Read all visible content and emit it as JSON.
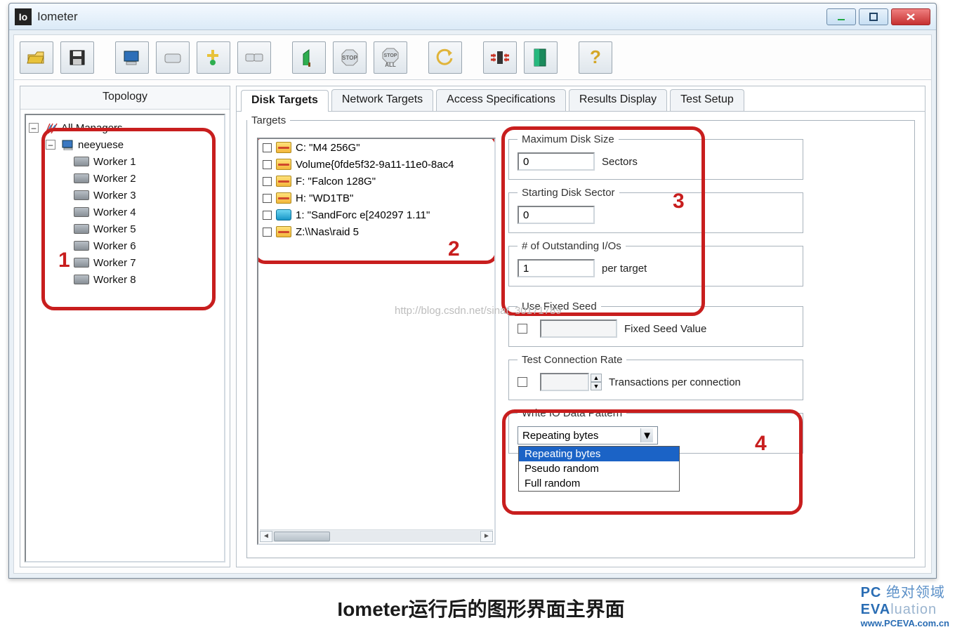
{
  "window": {
    "title": "Iometer",
    "app_icon_text": "Io"
  },
  "winbuttons": {
    "min": "minimize",
    "max": "maximize",
    "close": "close"
  },
  "toolbar": {
    "buttons": [
      {
        "name": "open",
        "color": "#e8c23a"
      },
      {
        "name": "save",
        "color": "#333"
      },
      {
        "name": "computer",
        "color": "#2d6fb8"
      },
      {
        "name": "add-manager",
        "color": "#888"
      },
      {
        "name": "add-worker",
        "color": "#2eae4f"
      },
      {
        "name": "copy-worker",
        "color": "#888"
      },
      {
        "name": "start",
        "color": "#2eae4f"
      },
      {
        "name": "stop",
        "color": "#b44"
      },
      {
        "name": "stop-all",
        "color": "#b44"
      },
      {
        "name": "reset",
        "color": "#e0b43a"
      },
      {
        "name": "dock",
        "color": "#c83426"
      },
      {
        "name": "exit",
        "color": "#1a8a5c"
      },
      {
        "name": "help",
        "color": "#d4a728"
      }
    ]
  },
  "topology": {
    "header": "Topology",
    "root": "All Managers",
    "manager": "neeyuese",
    "workers": [
      "Worker 1",
      "Worker 2",
      "Worker 3",
      "Worker 4",
      "Worker 5",
      "Worker 6",
      "Worker 7",
      "Worker 8"
    ]
  },
  "tabs": [
    "Disk Targets",
    "Network Targets",
    "Access Specifications",
    "Results Display",
    "Test Setup"
  ],
  "active_tab": 0,
  "targets_group": "Targets",
  "targets": [
    {
      "icon": "yellow",
      "label": "C: \"M4 256G\""
    },
    {
      "icon": "yellow",
      "label": "Volume{0fde5f32-9a11-11e0-8ac4"
    },
    {
      "icon": "yellow",
      "label": "F: \"Falcon 128G\""
    },
    {
      "icon": "yellow",
      "label": "H: \"WD1TB\""
    },
    {
      "icon": "blue",
      "label": "1: \"SandForc e[240297 1.11\""
    },
    {
      "icon": "yellow",
      "label": "Z:\\\\Nas\\raid 5"
    }
  ],
  "max_disk": {
    "legend": "Maximum Disk Size",
    "value": "0",
    "suffix": "Sectors"
  },
  "start_sector": {
    "legend": "Starting Disk Sector",
    "value": "0"
  },
  "outstanding": {
    "legend": "# of Outstanding I/Os",
    "value": "1",
    "suffix": "per target"
  },
  "fixed_seed": {
    "legend": "Use Fixed Seed",
    "value": "",
    "label": "Fixed Seed Value"
  },
  "conn_rate": {
    "legend": "Test Connection Rate",
    "value": "",
    "label": "Transactions per connection"
  },
  "write_pattern": {
    "legend": "Write IO Data Pattern",
    "selected": "Repeating bytes",
    "options": [
      "Repeating bytes",
      "Pseudo random",
      "Full random"
    ],
    "selected_index": 0
  },
  "watermark": "http://blog.csdn.net/sinat_30171789",
  "annotations": {
    "n1": "1",
    "n2": "2",
    "n3": "3",
    "n4": "4"
  },
  "caption": "Iometer运行后的图形界面主界面",
  "logo": {
    "line1_a": "PC",
    "line1_b": "绝对领域",
    "line2_a": "EVA",
    "line2_b": "luation",
    "url": "www.PCEVA.com.cn"
  }
}
